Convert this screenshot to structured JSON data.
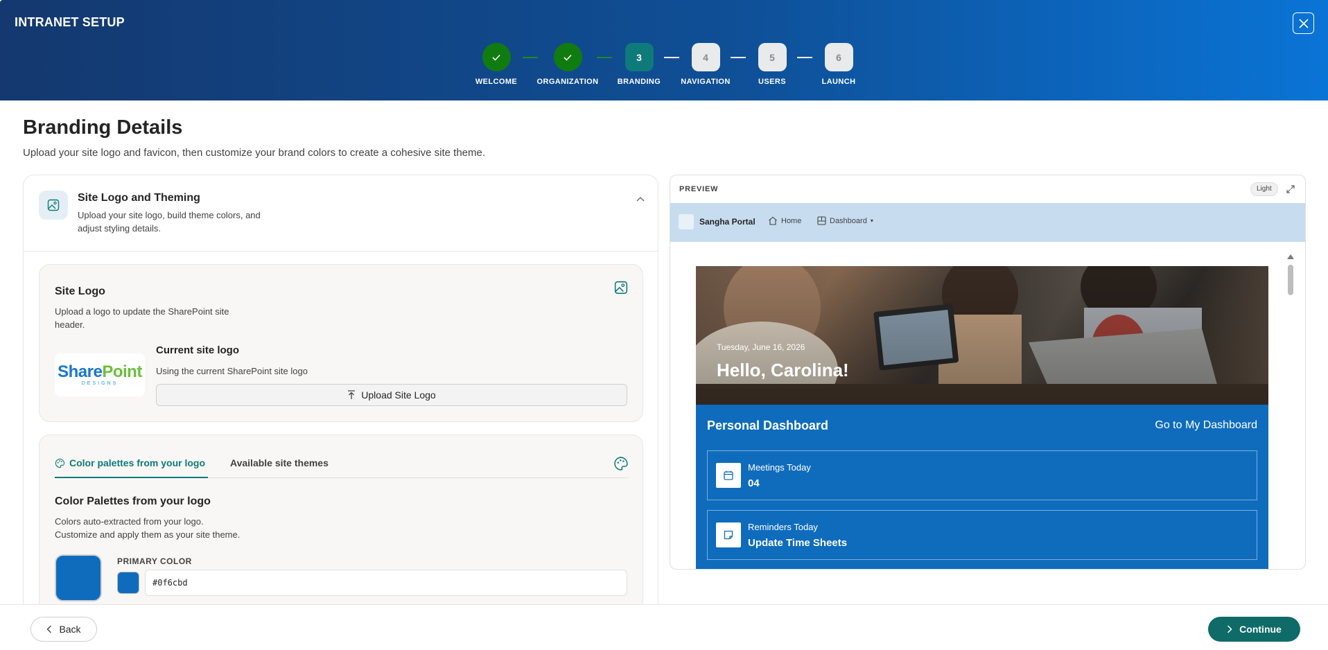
{
  "header": {
    "title": "INTRANET SETUP",
    "steps": [
      {
        "number": "1",
        "label": "WELCOME",
        "state": "done"
      },
      {
        "number": "2",
        "label": "ORGANIZATION",
        "state": "done"
      },
      {
        "number": "3",
        "label": "BRANDING",
        "state": "active"
      },
      {
        "number": "4",
        "label": "NAVIGATION",
        "state": "todo"
      },
      {
        "number": "5",
        "label": "USERS",
        "state": "todo"
      },
      {
        "number": "6",
        "label": "LAUNCH",
        "state": "todo"
      }
    ]
  },
  "page": {
    "title": "Branding Details",
    "subtitle": "Upload your site logo and favicon, then customize your brand colors to create a cohesive site theme."
  },
  "section": {
    "title": "Site Logo and Theming",
    "description": "Upload your site logo, build theme colors, and adjust styling details."
  },
  "site_logo": {
    "title": "Site Logo",
    "description": "Upload a logo to update the SharePoint site header.",
    "logo_text_1": "Share",
    "logo_text_2": "Point",
    "logo_sub": "DESIGNS",
    "current_title": "Current site logo",
    "current_desc": "Using the current SharePoint site logo",
    "upload_label": "Upload Site Logo"
  },
  "palette": {
    "tab_active": "Color palettes from your logo",
    "tab_inactive": "Available site themes",
    "title": "Color Palettes from your logo",
    "description": "Colors auto-extracted from your logo. Customize and apply them as your site theme.",
    "primary_label": "PRIMARY COLOR",
    "primary_value": "#0f6cbd"
  },
  "preview": {
    "label": "PREVIEW",
    "mode": "Light",
    "site_name": "Sangha Portal",
    "nav_home": "Home",
    "nav_dashboard": "Dashboard",
    "hero_date": "Tuesday, June 16, 2026",
    "hero_greeting": "Hello, Carolina!",
    "dashboard_title": "Personal Dashboard",
    "dashboard_link": "Go to My Dashboard",
    "tiles": [
      {
        "label": "Meetings Today",
        "value": "04",
        "icon": "calendar-icon"
      },
      {
        "label": "Reminders Today",
        "value": "Update Time Sheets",
        "icon": "note-icon"
      }
    ]
  },
  "footer": {
    "back_label": "Back",
    "continue_label": "Continue"
  },
  "colors": {
    "header_start": "#14386f",
    "header_end": "#0a74d6",
    "step_done": "#107c10",
    "step_active": "#0e7a7a",
    "accent": "#0e7a7a",
    "primary": "#0f6cbd",
    "continue": "#0e6b68"
  }
}
